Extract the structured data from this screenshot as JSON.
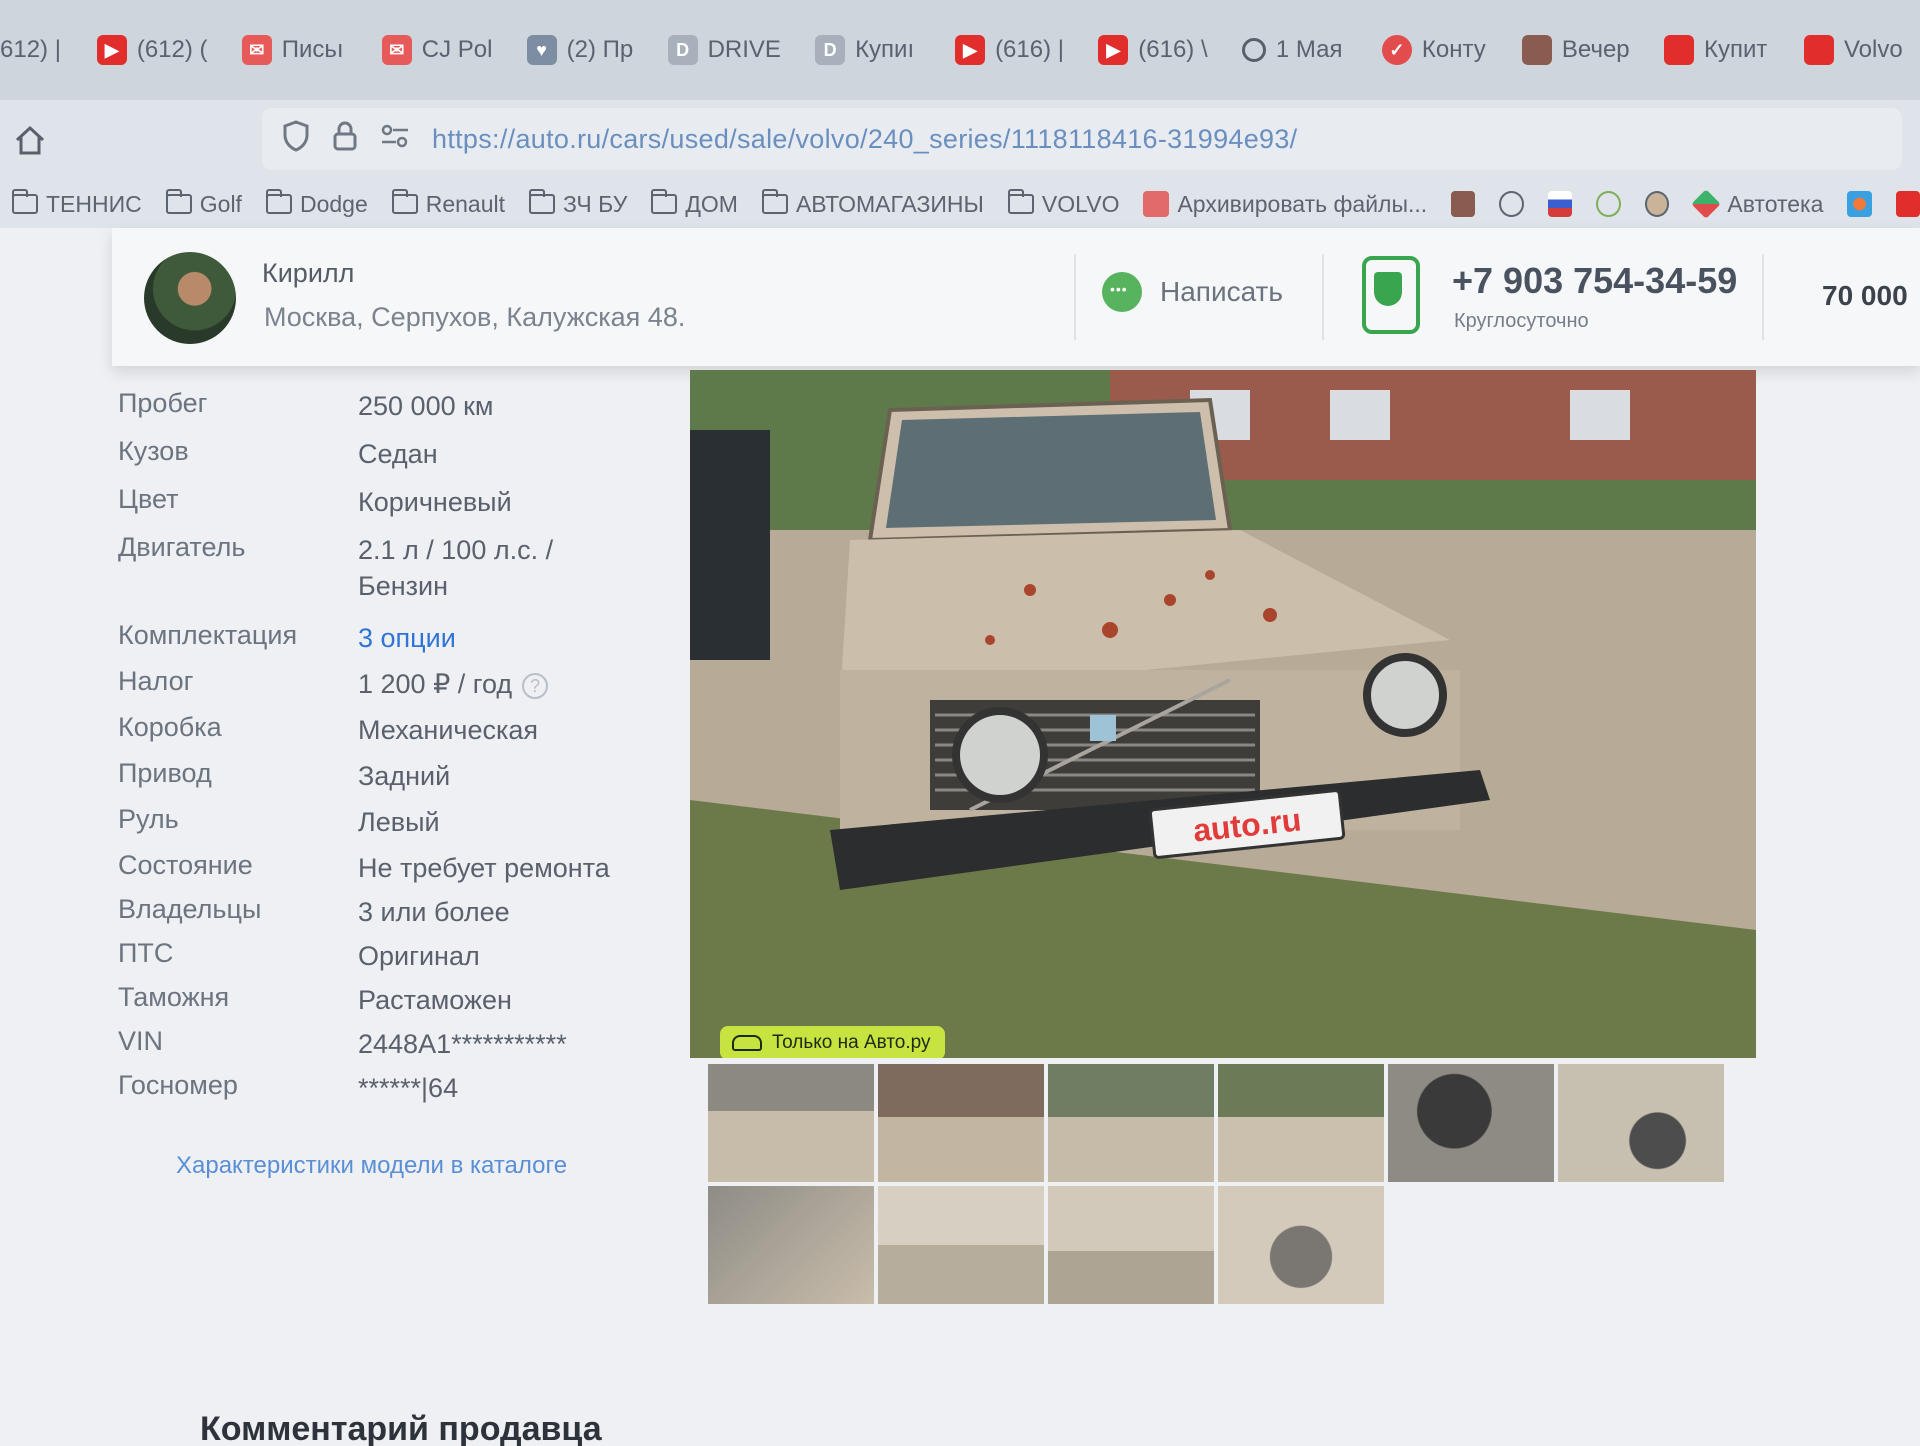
{
  "browser": {
    "tabs": [
      {
        "label": "612) |",
        "icon": "none"
      },
      {
        "label": "(612) (",
        "icon": "youtube-icon"
      },
      {
        "label": "Письı",
        "icon": "mail-icon"
      },
      {
        "label": "CJ Pol",
        "icon": "mail-icon"
      },
      {
        "label": "(2) Пр",
        "icon": "vk-icon"
      },
      {
        "label": "DRIVE",
        "icon": "d-icon"
      },
      {
        "label": "Купиı",
        "icon": "d-icon"
      },
      {
        "label": "(616) |",
        "icon": "youtube-icon"
      },
      {
        "label": "(616) \\",
        "icon": "youtube-icon"
      },
      {
        "label": "1 Мая",
        "icon": "search-icon"
      },
      {
        "label": "Конту",
        "icon": "red-circle-icon"
      },
      {
        "label": "Вечер",
        "icon": "car-icon"
      },
      {
        "label": "Купит",
        "icon": "autoru-icon"
      },
      {
        "label": "Volvo",
        "icon": "autoru-icon"
      }
    ],
    "url": "https://auto.ru/cars/used/sale/volvo/240_series/1118118416-31994e93/",
    "bookmarks": [
      {
        "label": "ТЕННИС",
        "type": "folder"
      },
      {
        "label": "Golf",
        "type": "folder"
      },
      {
        "label": "Dodge",
        "type": "folder"
      },
      {
        "label": "Renault",
        "type": "folder"
      },
      {
        "label": "ЗЧ БУ",
        "type": "folder"
      },
      {
        "label": "ДОМ",
        "type": "folder"
      },
      {
        "label": "АВТОМАГАЗИНЫ",
        "type": "folder"
      },
      {
        "label": "VOLVO",
        "type": "folder"
      },
      {
        "label": "Архивировать файлы...",
        "type": "link"
      },
      {
        "label": "Автотека",
        "type": "link"
      }
    ]
  },
  "seller": {
    "name": "Кирилл",
    "address": "Москва, Серпухов, Калужская 48.",
    "write_label": "Написать",
    "phone": "+7 903 754-34-59",
    "phone_note": "Круглосуточно",
    "price": "70 000"
  },
  "specs": [
    {
      "label": "Пробег",
      "value": "250 000 км"
    },
    {
      "label": "Кузов",
      "value": "Седан"
    },
    {
      "label": "Цвет",
      "value": "Коричневый"
    },
    {
      "label": "Двигатель",
      "value": "2.1 л / 100 л.с. /",
      "value2": "Бензин"
    },
    {
      "label": "Комплектация",
      "value": "3 опции",
      "link": true
    },
    {
      "label": "Налог",
      "value": "1 200 ₽ / год",
      "help": "?"
    },
    {
      "label": "Коробка",
      "value": "Механическая"
    },
    {
      "label": "Привод",
      "value": "Задний"
    },
    {
      "label": "Руль",
      "value": "Левый"
    },
    {
      "label": "Состояние",
      "value": "Не требует ремонта"
    },
    {
      "label": "Владельцы",
      "value": "3 или более"
    },
    {
      "label": "ПТС",
      "value": "Оригинал"
    },
    {
      "label": "Таможня",
      "value": "Растаможен"
    },
    {
      "label": "VIN",
      "value": "2448A1***********"
    },
    {
      "label": "Госномер",
      "value": "******|64"
    }
  ],
  "catalog_link": "Характеристики модели в каталоге",
  "photo": {
    "badge": "Только на Авто.ру",
    "plate": "auto.ru",
    "thumb_count": 10
  },
  "comment_title": "Комментарий продавца"
}
